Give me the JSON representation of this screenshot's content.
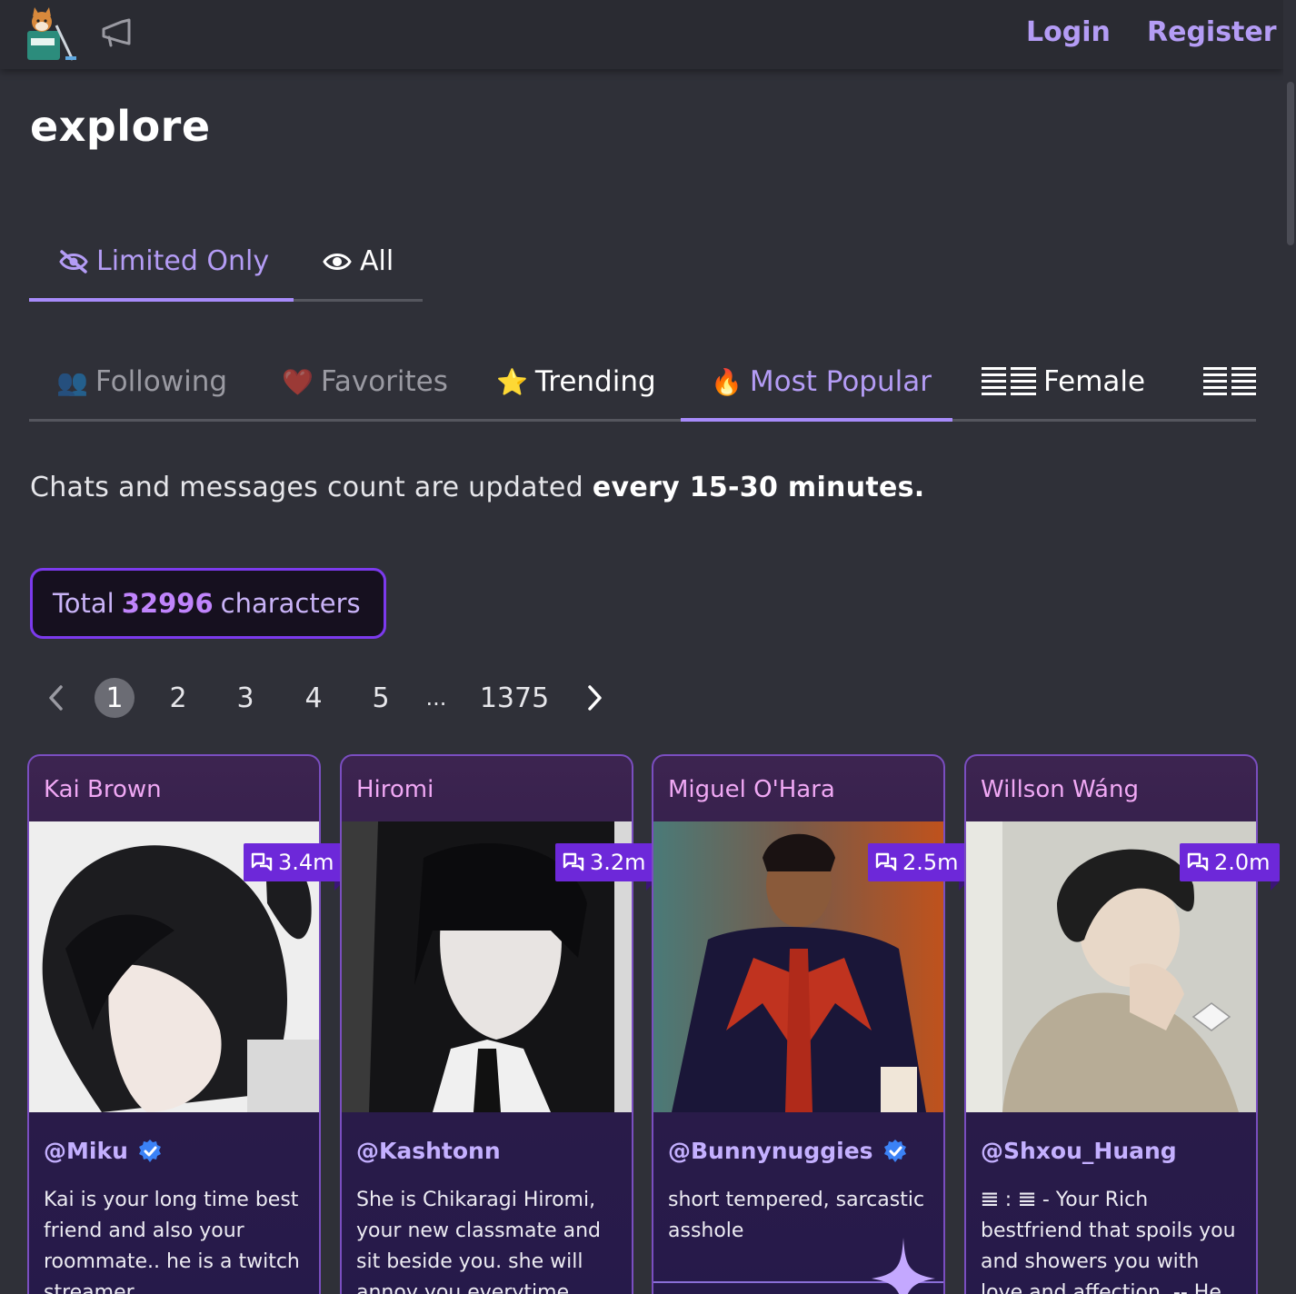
{
  "header": {
    "logo_icon": "shiba-bucket-logo-icon",
    "announce_icon": "megaphone-icon",
    "login": "Login",
    "register": "Register"
  },
  "page": {
    "title": "explore"
  },
  "visibility_tabs": [
    {
      "label": "Limited Only",
      "icon": "eye-slash-icon",
      "active": true
    },
    {
      "label": "All",
      "icon": "eye-icon",
      "active": false
    }
  ],
  "category_tabs": [
    {
      "label": "Following",
      "emoji": "👥",
      "active": false
    },
    {
      "label": "Favorites",
      "emoji": "❤️",
      "active": false
    },
    {
      "label": "Trending",
      "emoji": "⭐",
      "active": false
    },
    {
      "label": "Most Popular",
      "emoji": "🔥",
      "active": true
    },
    {
      "label": "Female",
      "emoji": "",
      "active": false
    },
    {
      "label": "",
      "emoji": "",
      "active": false
    }
  ],
  "notice": {
    "prefix": "Chats and messages count are updated",
    "bold": "every 15-30 minutes."
  },
  "total": {
    "prefix": "Total",
    "count": "32996",
    "suffix": "characters"
  },
  "pagination": {
    "pages": [
      "1",
      "2",
      "3",
      "4",
      "5",
      "...",
      "1375"
    ],
    "current": "1"
  },
  "cards": [
    {
      "name": "Kai Brown",
      "chats": "3.4m",
      "author": "@Miku",
      "verified": true,
      "description": "Kai is your long time best friend and also your roommate.. he is a twitch streamer"
    },
    {
      "name": "Hiromi",
      "chats": "3.2m",
      "author": "@Kashtonn",
      "verified": false,
      "description": "She is Chikaragi Hiromi, your new classmate and sit beside you. she will annoy you everytime"
    },
    {
      "name": "Miguel O'Hara",
      "chats": "2.5m",
      "author": "@Bunnynuggies",
      "verified": true,
      "description": "short tempered, sarcastic asshole"
    },
    {
      "name": "Willson Wáng",
      "chats": "2.0m",
      "author": "@Shxou_Huang",
      "verified": false,
      "description": "𝌆 : 𝌆 - Your Rich bestfriend that spoils you and showers you with love and affection. -- He was"
    }
  ],
  "colors": {
    "accent": "#a78bfa",
    "badge": "#6d28d9",
    "card_border": "#7a4ec0",
    "background": "#2f3038"
  }
}
